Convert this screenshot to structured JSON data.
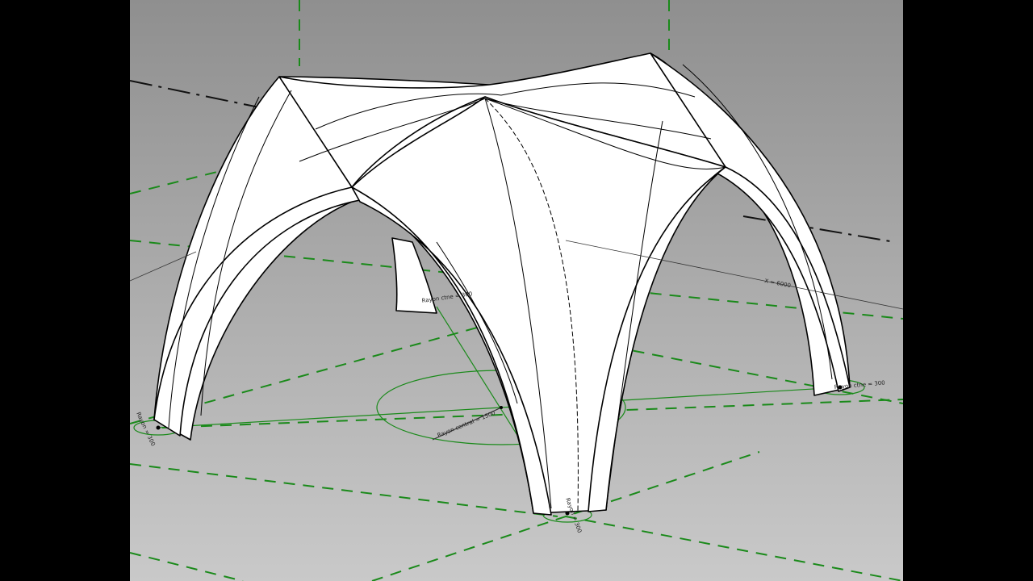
{
  "viewport": {
    "background_top": "#8f8f8f",
    "background_bottom": "#c9c9c9",
    "grid_color": "#1a8a1a",
    "axis_color": "#111111",
    "model_fill": "#ffffff",
    "model_stroke": "#000000"
  },
  "dimensions": {
    "rayon_central": "Rayon central = 1500",
    "rayon_front": "Rayon ctne = 300",
    "rayon_right": "Rayon ctne = 300",
    "rayon_left": "Rayon = 300",
    "rayon_bottom": "Rayon = 300",
    "x_dim": "X = 6000"
  }
}
